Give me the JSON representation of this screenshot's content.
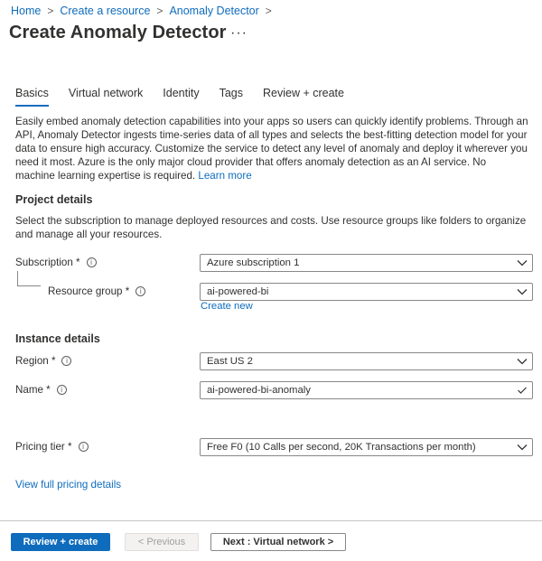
{
  "breadcrumb": {
    "items": [
      "Home",
      "Create a resource",
      "Anomaly Detector"
    ],
    "separator": ">"
  },
  "page": {
    "title": "Create Anomaly Detector",
    "more": "···"
  },
  "tabs": [
    {
      "label": "Basics",
      "active": true
    },
    {
      "label": "Virtual network",
      "active": false
    },
    {
      "label": "Identity",
      "active": false
    },
    {
      "label": "Tags",
      "active": false
    },
    {
      "label": "Review + create",
      "active": false
    }
  ],
  "intro": {
    "text": "Easily embed anomaly detection capabilities into your apps so users can quickly identify problems. Through an API, Anomaly Detector ingests time-series data of all types and selects the best-fitting detection model for your data to ensure high accuracy. Customize the service to detect any level of anomaly and deploy it wherever you need it most. Azure is the only major cloud provider that offers anomaly detection as an AI service. No machine learning expertise is required.",
    "learn_more": "Learn more"
  },
  "project": {
    "heading": "Project details",
    "description": "Select the subscription to manage deployed resources and costs. Use resource groups like folders to organize and manage all your resources.",
    "subscription_label": "Subscription *",
    "subscription_value": "Azure subscription 1",
    "resource_group_label": "Resource group *",
    "resource_group_value": "ai-powered-bi",
    "create_new": "Create new"
  },
  "instance": {
    "heading": "Instance details",
    "region_label": "Region *",
    "region_value": "East US 2",
    "name_label": "Name *",
    "name_value": "ai-powered-bi-anomaly",
    "pricing_label": "Pricing tier *",
    "pricing_value": "Free F0 (10 Calls per second, 20K Transactions per month)",
    "pricing_link": "View full pricing details"
  },
  "footer": {
    "review_create": "Review + create",
    "previous": "< Previous",
    "next": "Next : Virtual network >"
  },
  "colors": {
    "accent": "#0f6cbd",
    "text": "#323130",
    "border": "#8a8886"
  },
  "icons": {
    "info": "info-icon",
    "chevron": "chevron-down-icon",
    "check": "check-icon"
  }
}
